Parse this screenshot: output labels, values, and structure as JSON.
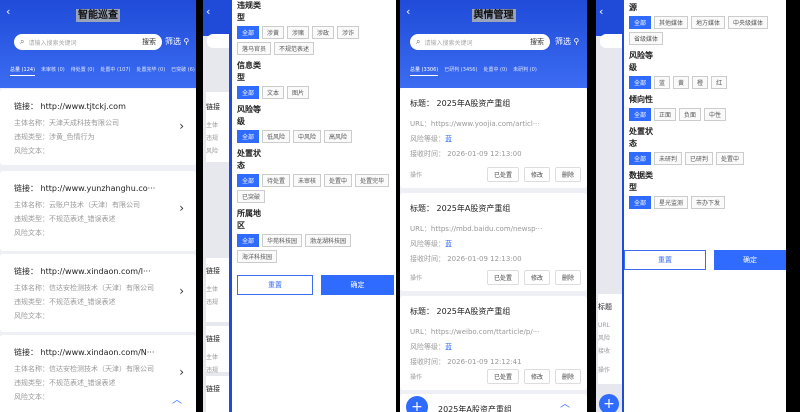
{
  "screen1": {
    "title": "智能巡查",
    "search_placeholder": "请输入搜索关键词",
    "search_btn": "搜索",
    "filter": "筛选",
    "tabs": [
      "总量 (124)",
      "未审核 (0)",
      "待处置 (0)",
      "处置中 (107)",
      "处置完毕 (0)",
      "已突破 (6)"
    ],
    "cards": [
      {
        "link": "链接：  http://www.tjtckj.com",
        "subject": "主体名称：天津天成科技有限公司",
        "vtype": "违规类型：涉黄_色情行为",
        "text": "风险文本："
      },
      {
        "link": "链接：  http://www.yunzhanghu.co···",
        "subject": "主体名称：云账户技术（天津）有限公司",
        "vtype": "违规类型：不规范表述_错误表述",
        "text": "风险文本："
      },
      {
        "link": "链接：  http://www.xindaon.com/l···",
        "subject": "主体名称：信达安检测技术（天津）有限公司",
        "vtype": "违规类型：不规范表述_错误表述",
        "text": "风险文本："
      },
      {
        "link": "链接：  http://www.xindaon.com/N···",
        "subject": "主体名称：信达安检测技术（天津）有限公司",
        "vtype": "违规类型：不规范表述_错误表述",
        "text": "风险文本："
      }
    ]
  },
  "screen2": {
    "bg_labels": [
      "链接",
      "主体",
      "违规",
      "风险",
      "链接",
      "主体",
      "违规",
      "链接",
      "主体",
      "违规",
      "链接"
    ],
    "sections": [
      {
        "title": "违规类型",
        "chips": [
          "全部",
          "涉黄",
          "涉赌",
          "涉政",
          "涉诈",
          "落马官员",
          "不规范表述"
        ]
      },
      {
        "title": "信息类型",
        "chips": [
          "全部",
          "文本",
          "图片"
        ]
      },
      {
        "title": "风险等级",
        "chips": [
          "全部",
          "低风险",
          "中风险",
          "高风险"
        ]
      },
      {
        "title": "处置状态",
        "chips": [
          "全部",
          "待处置",
          "未审核",
          "处置中",
          "处置完毕",
          "已突破"
        ]
      },
      {
        "title": "所属地区",
        "chips": [
          "全部",
          "华苑科技园",
          "渤龙湖科技园",
          "海洋科技园"
        ]
      }
    ],
    "reset": "重置",
    "confirm": "确定"
  },
  "screen3": {
    "title": "舆情管理",
    "search_placeholder": "请输入搜索关键词",
    "search_btn": "搜索",
    "filter": "筛选",
    "tabs": [
      "总量 (3306)",
      "已研判 (3456)",
      "处置中 (0)",
      "未研判 (0)"
    ],
    "cards": [
      {
        "title": "标题：   2025年A股资产重组",
        "url": "URL：https://www.yoojia.com/articl···",
        "risk_label": "风险等级：",
        "risk": "蓝",
        "time": "接收时间：  2026-01-09 12:13:00"
      },
      {
        "title": "标题：   2025年A股资产重组",
        "url": "URL：https://mbd.baidu.com/newsp···",
        "risk_label": "风险等级：",
        "risk": "蓝",
        "time": "接收时间：  2026-01-09 12:13:00"
      },
      {
        "title": "标题：   2025年A股资产重组",
        "url": "URL：https://weibo.com/ttarticle/p/···",
        "risk_label": "风险等级：",
        "risk": "蓝",
        "time": "接收时间：  2026-01-09 12:12:41"
      }
    ],
    "ops_label": "操作",
    "ops": [
      "已处置",
      "修改",
      "删除"
    ],
    "peek_title": "2025年A股资产重组"
  },
  "screen4": {
    "sections": [
      {
        "title": "数据来源",
        "chips": [
          "全部",
          "其他媒体",
          "地方媒体",
          "中央级媒体",
          "省级媒体"
        ]
      },
      {
        "title": "风险等级",
        "chips": [
          "全部",
          "蓝",
          "黄",
          "橙",
          "红"
        ]
      },
      {
        "title": "倾向性",
        "chips": [
          "全部",
          "正面",
          "负面",
          "中性"
        ]
      },
      {
        "title": "处置状态",
        "chips": [
          "全部",
          "未研判",
          "已研判",
          "处置中"
        ]
      },
      {
        "title": "数据类型",
        "chips": [
          "全部",
          "星光监测",
          "市办下发"
        ]
      }
    ],
    "reset": "重置",
    "confirm": "确定",
    "bg_labels": [
      "标题",
      "URL",
      "风险",
      "接收",
      "操作"
    ]
  }
}
